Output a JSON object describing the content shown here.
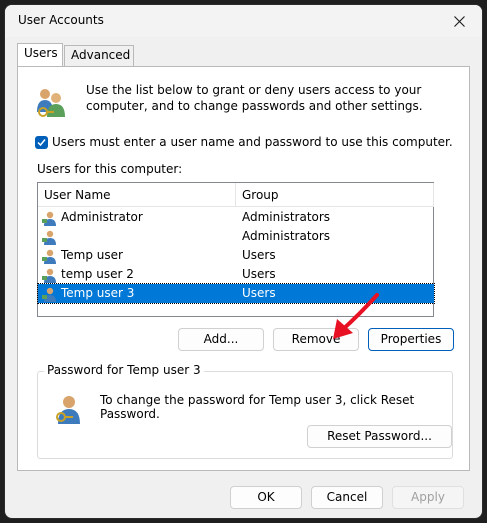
{
  "window": {
    "title": "User Accounts"
  },
  "tabs": [
    {
      "label": "Users",
      "active": true
    },
    {
      "label": "Advanced",
      "active": false
    }
  ],
  "intro": {
    "text": "Use the list below to grant or deny users access to your computer, and to change passwords and other settings."
  },
  "require_login": {
    "label": "Users must enter a user name and password to use this computer.",
    "checked": true
  },
  "users_section": {
    "label": "Users for this computer:"
  },
  "users_table": {
    "columns": [
      "User Name",
      "Group"
    ],
    "rows": [
      {
        "name": "Administrator",
        "group": "Administrators",
        "selected": false
      },
      {
        "name": "",
        "group": "Administrators",
        "selected": false
      },
      {
        "name": "Temp user",
        "group": "Users",
        "selected": false
      },
      {
        "name": "temp user 2",
        "group": "Users",
        "selected": false
      },
      {
        "name": "Temp user 3",
        "group": "Users",
        "selected": true
      }
    ]
  },
  "user_buttons": {
    "add": "Add...",
    "remove": "Remove",
    "properties": "Properties"
  },
  "password_group": {
    "title": "Password for Temp user 3",
    "text": "To change the password for Temp user 3, click Reset Password.",
    "reset_button": "Reset Password..."
  },
  "footer_buttons": {
    "ok": "OK",
    "cancel": "Cancel",
    "apply": "Apply"
  },
  "colors": {
    "accent": "#005fb8",
    "selection": "#0078d7",
    "annotation_arrow": "#e81123"
  },
  "icons": {
    "close": "close-icon",
    "users_group": "users-group-icon",
    "user": "user-icon",
    "user_key": "user-key-icon",
    "check": "check-icon",
    "arrow": "red-arrow-icon"
  }
}
